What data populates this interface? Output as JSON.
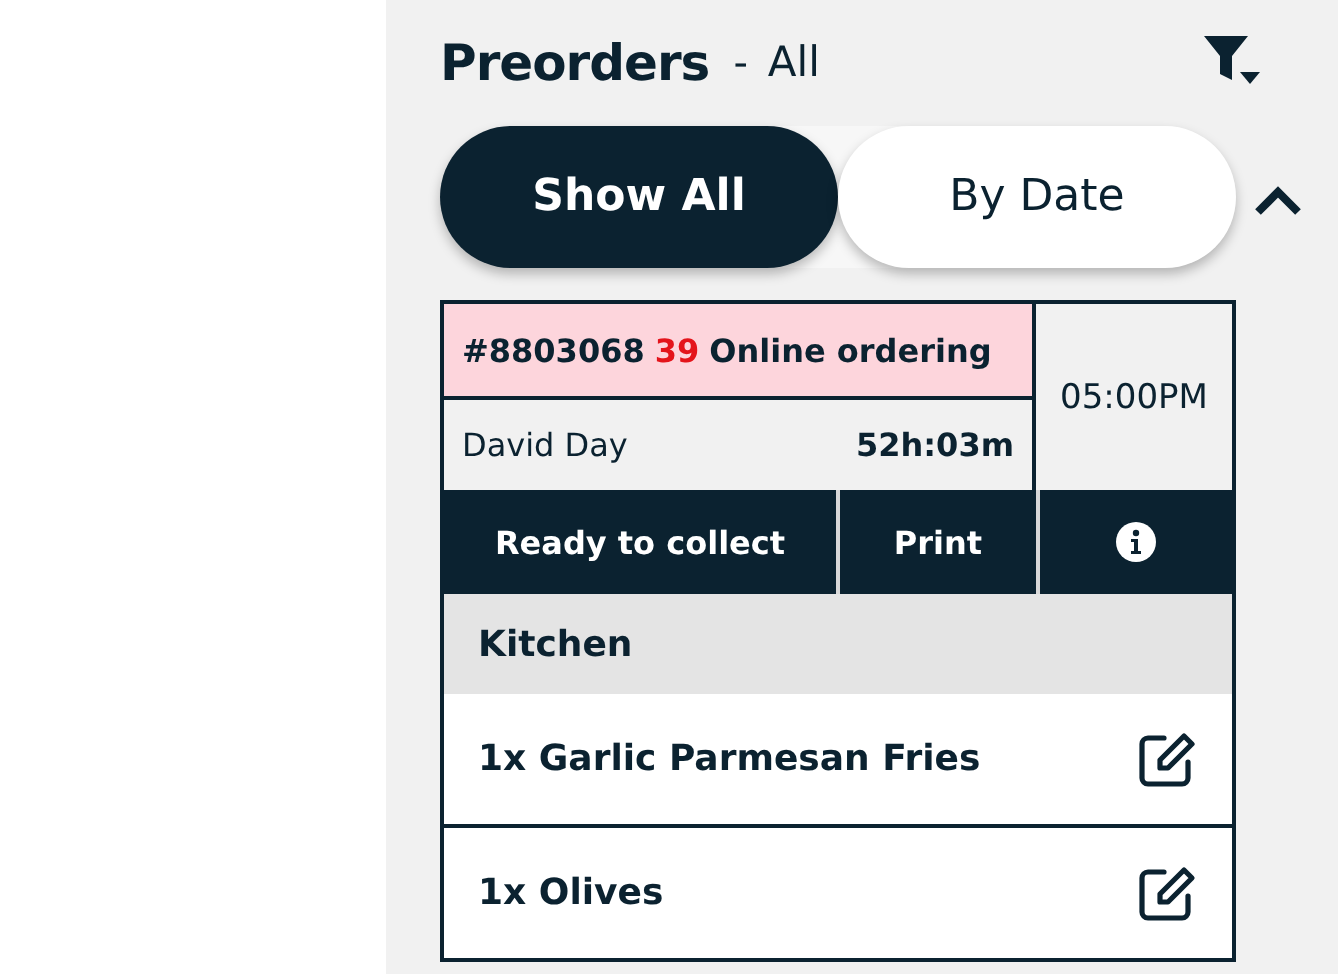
{
  "header": {
    "title": "Preorders",
    "separator": "-",
    "filter": "All"
  },
  "toggle": [
    {
      "label": "Show All",
      "selected": true
    },
    {
      "label": "By Date",
      "selected": false
    }
  ],
  "order": {
    "number": "#8803068",
    "table": "39",
    "source": "Online ordering",
    "customer": "David Day",
    "elapsed": "52h:03m",
    "time": "05:00PM",
    "expanded": true,
    "actions": [
      {
        "kind": "text",
        "label": "Ready to collect"
      },
      {
        "kind": "text",
        "label": "Print"
      },
      {
        "kind": "info"
      }
    ],
    "section": "Kitchen",
    "items": [
      {
        "label": "1x Garlic Parmesan Fries"
      },
      {
        "label": "1x Olives"
      }
    ]
  }
}
